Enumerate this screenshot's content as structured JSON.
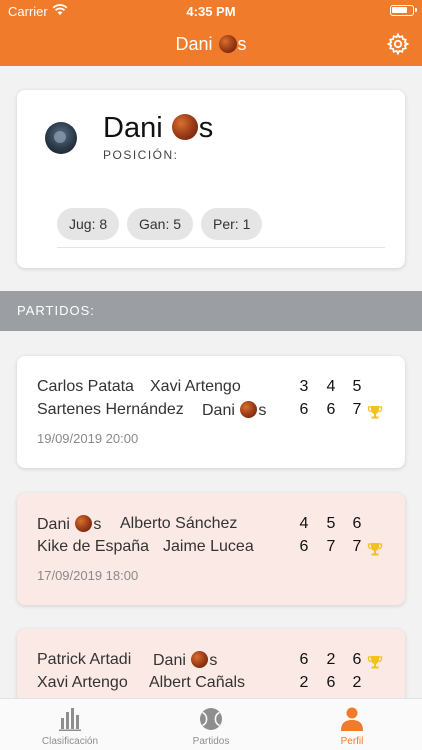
{
  "status_bar": {
    "carrier": "Carrier",
    "time": "4:35 PM"
  },
  "nav": {
    "title": "Dani",
    "title_suffix": "s",
    "settings_icon": "gear-icon"
  },
  "profile": {
    "name": "Dani",
    "name_suffix": "s",
    "position_label": "POSICIÓN:",
    "stats": [
      {
        "label": "Jug: 8"
      },
      {
        "label": "Gan: 5"
      },
      {
        "label": "Per: 1"
      }
    ]
  },
  "section": {
    "label": "PARTIDOS:"
  },
  "matches": [
    {
      "highlight": false,
      "team1": {
        "p1": "Carlos Patata",
        "p2": "Xavi Artengo",
        "scores": [
          "3",
          "4",
          "5"
        ]
      },
      "team2": {
        "p1": "Sartenes Hernández",
        "p2": "Dani",
        "p2_suffix": "s",
        "scores": [
          "6",
          "6",
          "7"
        ],
        "winner": true
      },
      "date": "19/09/2019 20:00"
    },
    {
      "highlight": true,
      "team1": {
        "p1": "Dani",
        "p1_suffix": "s",
        "p2": "Alberto Sánchez",
        "scores": [
          "4",
          "5",
          "6"
        ]
      },
      "team2": {
        "p1": "Kike de España",
        "p2": "Jaime Lucea",
        "scores": [
          "6",
          "7",
          "7"
        ],
        "winner": true
      },
      "date": "17/09/2019 18:00"
    },
    {
      "highlight": true,
      "team1": {
        "p1": "Patrick Artadi",
        "p2": "Dani",
        "p2_suffix": "s",
        "scores": [
          "6",
          "2",
          "6"
        ],
        "winner": true
      },
      "team2": {
        "p1": "Xavi Artengo",
        "p2": "Albert Cañals",
        "scores": [
          "2",
          "6",
          "2"
        ]
      }
    }
  ],
  "tabs": [
    {
      "label": "Clasificación",
      "icon": "bar-chart-icon"
    },
    {
      "label": "Partidos",
      "icon": "ball-icon"
    },
    {
      "label": "Perfil",
      "icon": "person-icon",
      "active": true
    }
  ],
  "colors": {
    "accent": "#f07b2b",
    "section_bg": "#9b9ea3",
    "highlight_card": "#fbe9e5",
    "trophy": "#f2c21b"
  }
}
